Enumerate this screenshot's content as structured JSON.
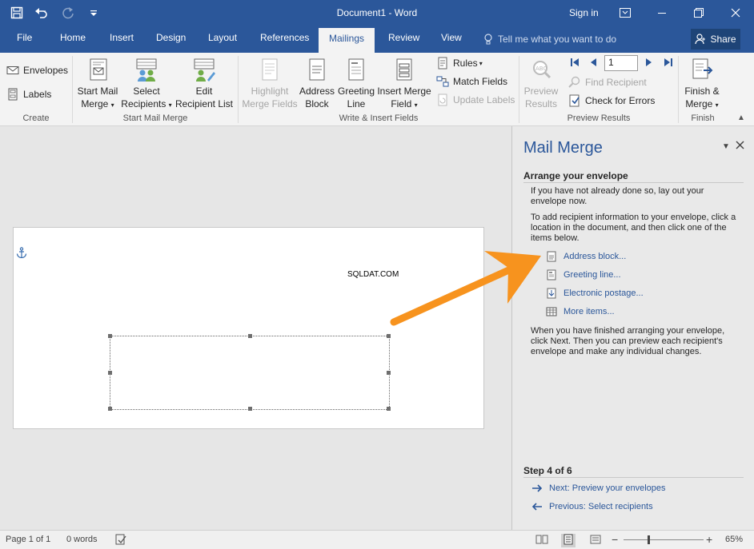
{
  "window": {
    "title": "Document1 - Word",
    "sign_in": "Sign in",
    "controls": [
      "ribbon-display-icon",
      "minimize-icon",
      "restore-icon",
      "close-icon"
    ]
  },
  "quick_access": [
    "save-icon",
    "undo-icon",
    "redo-icon",
    "customize-icon"
  ],
  "tabs": {
    "file": "File",
    "home": "Home",
    "insert": "Insert",
    "design": "Design",
    "layout": "Layout",
    "references": "References",
    "mailings": "Mailings",
    "review": "Review",
    "view": "View",
    "active": "Mailings"
  },
  "tell_me": "Tell me what you want to do",
  "share": "Share",
  "ribbon": {
    "create": {
      "label": "Create",
      "envelopes": "Envelopes",
      "labels": "Labels"
    },
    "start_mail_merge": {
      "label": "Start Mail Merge",
      "start_line1": "Start Mail",
      "start_line2": "Merge",
      "select_line1": "Select",
      "select_line2": "Recipients",
      "edit_line1": "Edit",
      "edit_line2": "Recipient List"
    },
    "write_insert": {
      "label": "Write & Insert Fields",
      "highlight_line1": "Highlight",
      "highlight_line2": "Merge Fields",
      "address_line1": "Address",
      "address_line2": "Block",
      "greeting_line1": "Greeting",
      "greeting_line2": "Line",
      "insert_line1": "Insert Merge",
      "insert_line2": "Field",
      "rules": "Rules",
      "match_fields": "Match Fields",
      "update_labels": "Update Labels"
    },
    "preview": {
      "label": "Preview Results",
      "preview_line1": "Preview",
      "preview_line2": "Results",
      "record": "1",
      "find_recipient": "Find Recipient",
      "check_errors": "Check for Errors"
    },
    "finish": {
      "label": "Finish",
      "finish_line1": "Finish &",
      "finish_line2": "Merge"
    }
  },
  "document": {
    "return_address": "SQLDAT.COM"
  },
  "pane": {
    "title": "Mail Merge",
    "heading": "Arrange your envelope",
    "para1": "If you have not already done so, lay out your envelope now.",
    "para2": "To add recipient information to your envelope, click a location in the document, and then click one of the items below.",
    "links": {
      "address_block": "Address block...",
      "greeting_line": "Greeting line...",
      "electronic_postage": "Electronic postage...",
      "more_items": "More items..."
    },
    "para3": "When you have finished arranging your envelope, click Next. Then you can preview each recipient's envelope and make any individual changes.",
    "step": "Step 4 of 6",
    "next": "Next: Preview your envelopes",
    "previous": "Previous: Select recipients"
  },
  "status": {
    "page": "Page 1 of 1",
    "words": "0 words",
    "zoom": "65%",
    "zoom_fraction": 0.65
  },
  "colors": {
    "title_bar": "#2b579a",
    "ribbon": "#f3f3f3",
    "arrow": "#f7931e",
    "link": "#2b579a"
  }
}
